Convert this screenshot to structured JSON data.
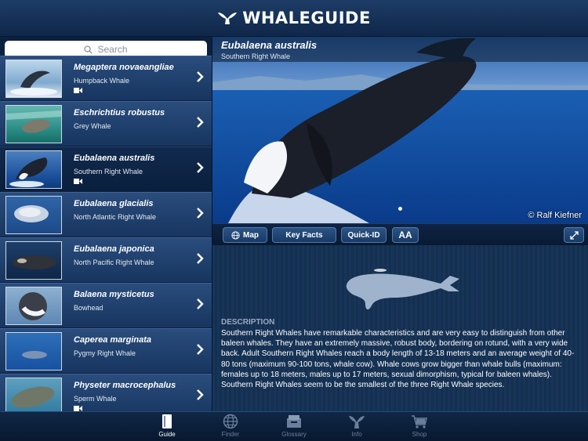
{
  "header": {
    "app_title": "WHALEGUIDE"
  },
  "search": {
    "placeholder": "Search"
  },
  "list": [
    {
      "sci": "Megaptera novaeangliae",
      "common": "Humpback Whale",
      "video": true
    },
    {
      "sci": "Eschrichtius robustus",
      "common": "Grey Whale",
      "video": true
    },
    {
      "sci": "Eubalaena australis",
      "common": "Southern Right Whale",
      "video": true
    },
    {
      "sci": "Eubalaena glacialis",
      "common": "North Atlantic Right Whale",
      "video": false
    },
    {
      "sci": "Eubalaena japonica",
      "common": "North Pacific Right Whale",
      "video": false
    },
    {
      "sci": "Balaena mysticetus",
      "common": "Bowhead",
      "video": false
    },
    {
      "sci": "Caperea marginata",
      "common": "Pygmy Right Whale",
      "video": false
    },
    {
      "sci": "Physeter macrocephalus",
      "common": "Sperm Whale",
      "video": true
    }
  ],
  "detail": {
    "sci": "Eubalaena australis",
    "common": "Southern Right Whale",
    "photo_credit": "© Ralf Kiefner",
    "desc_title": "DESCRIPTION",
    "desc_body": "Southern Right Whales have remarkable characteristics and are very easy to distinguish from other baleen whales. They have an extremely massive, robust body, bordering on rotund, with a very wide back. Adult Southern Right Whales reach a body length of 13-18 meters and an average weight of 40-80 tons (maximum 90-100 tons, whale cow). Whale cows grow bigger than whale bulls (maximum: females up to 18 meters, males up to 17 meters, sexual dimorphism, typical for baleen whales). Southern Right Whales seem to be the smallest of the three Right Whale species."
  },
  "toolbar": {
    "map": "Map",
    "key_facts": "Key Facts",
    "quick_id": "Quick-ID",
    "text_size": "AA"
  },
  "tabs": [
    {
      "label": "Guide",
      "icon": "book-icon"
    },
    {
      "label": "Finder",
      "icon": "globe-icon"
    },
    {
      "label": "Glossary",
      "icon": "glossary-box-icon"
    },
    {
      "label": "Info",
      "icon": "whale-tail-icon"
    },
    {
      "label": "Shop",
      "icon": "cart-icon"
    }
  ],
  "colors": {
    "background": "#0e2444",
    "accent": "#2b5385",
    "silhouette": "#9fb4cc"
  }
}
